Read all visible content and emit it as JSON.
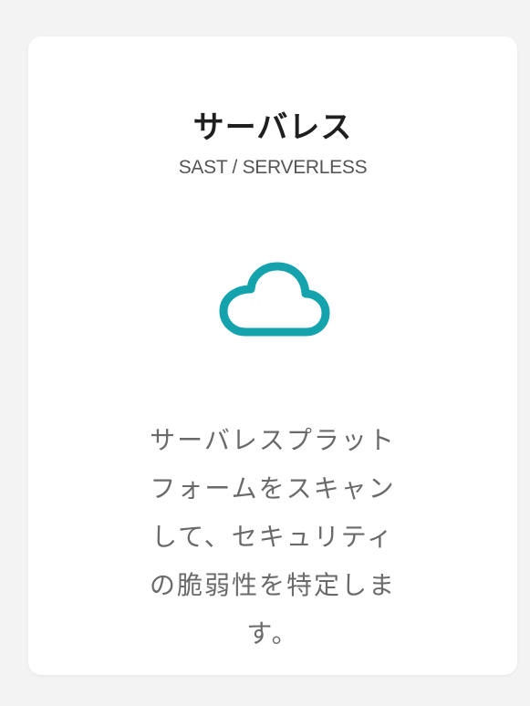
{
  "card": {
    "title": "サーバレス",
    "subtitle": "SAST / SERVERLESS",
    "icon": "cloud-icon",
    "description": "サーバレスプラット\nフォームをスキャン\nして、セキュリティ\nの脆弱性を特定しま\nす。"
  },
  "colors": {
    "accent": "#14a3ad",
    "title": "#1f1f1f",
    "subtitle": "#555555",
    "body": "#6a6a6a",
    "background": "#f3f3f3",
    "card": "#ffffff"
  }
}
